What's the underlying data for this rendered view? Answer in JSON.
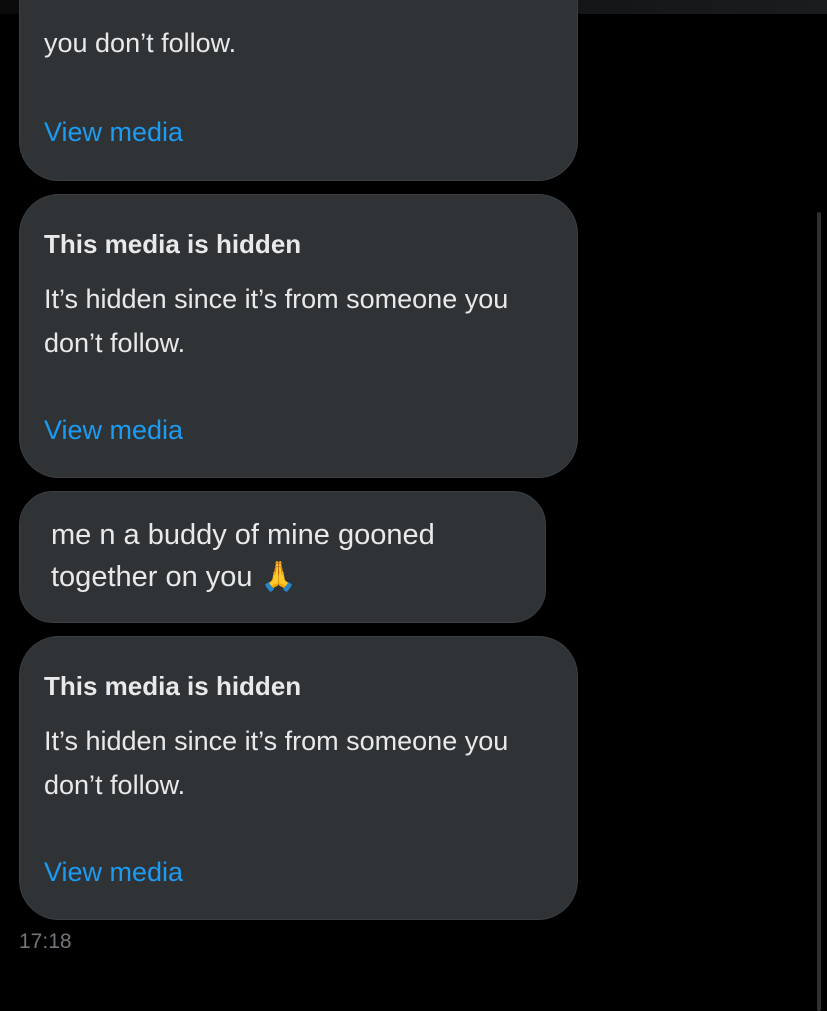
{
  "messages": {
    "partial": {
      "body": "you don’t follow.",
      "link": "View media"
    },
    "hidden_1": {
      "title": "This media is hidden",
      "body": "It’s hidden since it’s from someone you don’t follow.",
      "link": "View media"
    },
    "text": {
      "body": "me n a buddy of mine gooned together on you 🙏"
    },
    "hidden_2": {
      "title": "This media is hidden",
      "body": "It’s hidden since it’s from someone you don’t follow.",
      "link": "View media"
    }
  },
  "timestamp": "17:18",
  "colors": {
    "background": "#000000",
    "bubble": "#2f3336",
    "text": "#e7e9ea",
    "link": "#1d9bf0",
    "muted": "#71767b"
  }
}
